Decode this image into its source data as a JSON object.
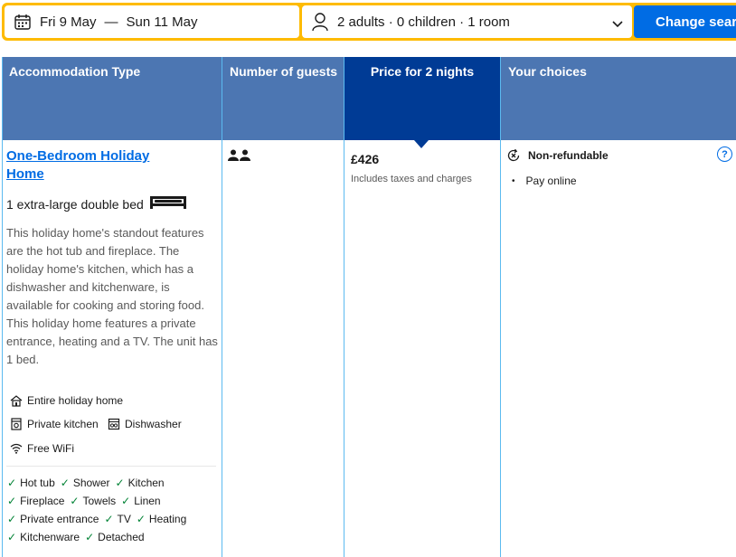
{
  "search": {
    "check_in": "Fri 9 May",
    "separator": "—",
    "check_out": "Sun 11 May",
    "occupancy": "2 adults · 0 children · 1 room",
    "button_label": "Change search"
  },
  "table": {
    "headers": {
      "type": "Accommodation Type",
      "guests": "Number of guests",
      "price": "Price for 2 nights",
      "choices": "Your choices"
    }
  },
  "room": {
    "name_line1": "One-Bedroom Holiday",
    "name_line2": "Home",
    "bed": "1 extra-large double bed",
    "description": "This holiday home's standout features are the hot tub and fireplace. The holiday home's kitchen, which has a dishwasher and kitchenware, is available for cooking and storing food. This holiday home features a private entrance, heating and a TV. The unit has 1 bed.",
    "features": [
      {
        "label": "Entire holiday home",
        "icon": "house-icon"
      },
      {
        "label": "Private kitchen",
        "icon": "kitchen-icon"
      },
      {
        "label": "Dishwasher",
        "icon": "dishwasher-icon"
      },
      {
        "label": "Free WiFi",
        "icon": "wifi-icon"
      }
    ],
    "amenities": [
      "Hot tub",
      "Shower",
      "Kitchen",
      "Fireplace",
      "Towels",
      "Linen",
      "Private entrance",
      "TV",
      "Heating",
      "Kitchenware",
      "Detached"
    ]
  },
  "price": {
    "amount": "£426",
    "note": "Includes taxes and charges"
  },
  "choices": {
    "policy": "Non-refundable",
    "payment": "Pay online"
  },
  "colors": {
    "header_bg": "#4c76b2",
    "price_header_bg": "#003b95",
    "accent": "#006ce4",
    "search_border": "#febb02",
    "check": "#008234"
  }
}
